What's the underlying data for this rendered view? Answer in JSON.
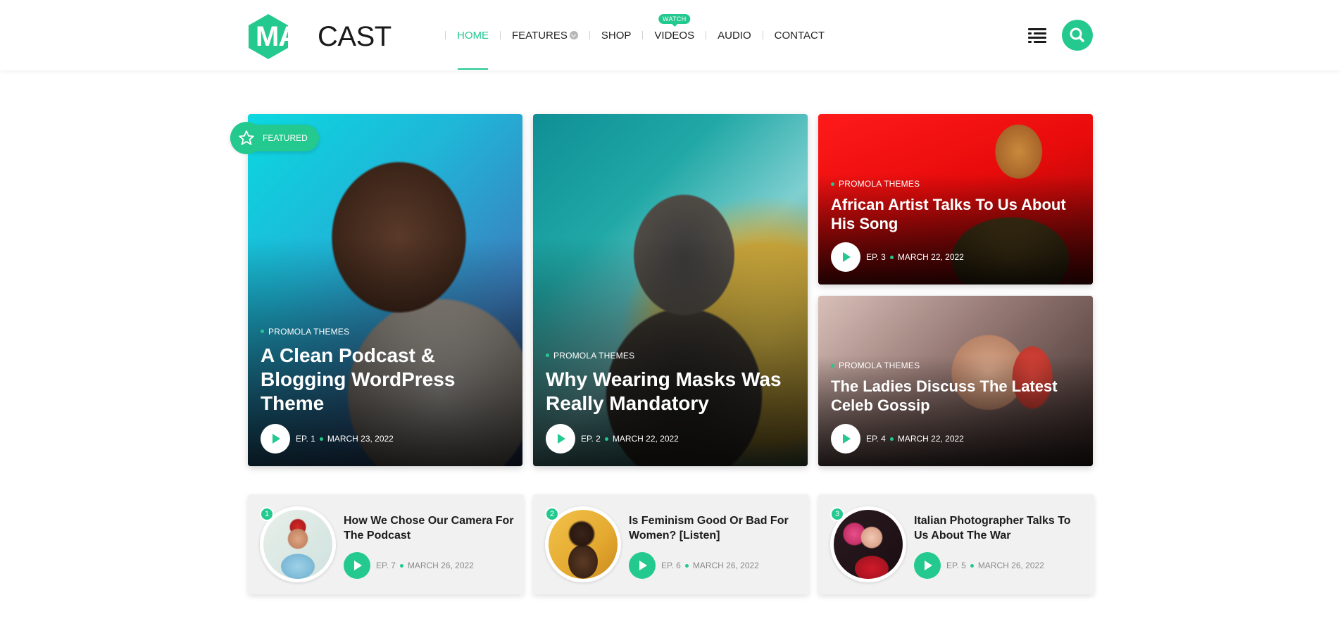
{
  "brand": {
    "logo_part1": "MAX",
    "logo_part2": "CAST",
    "accent": "#23c98f"
  },
  "nav": {
    "items": [
      {
        "label": "HOME",
        "active": true
      },
      {
        "label": "FEATURES",
        "has_dropdown": true
      },
      {
        "label": "SHOP"
      },
      {
        "label": "VIDEOS",
        "badge": "WATCH"
      },
      {
        "label": "AUDIO"
      },
      {
        "label": "CONTACT"
      }
    ]
  },
  "header_icons": {
    "menu": "menu-lines-icon",
    "search": "search-icon"
  },
  "featured_badge": "FEATURED",
  "cards": [
    {
      "category": "PROMOLA THEMES",
      "title": "A Clean Podcast & Blogging WordPress Theme",
      "episode": "EP. 1",
      "date": "MARCH 23, 2022"
    },
    {
      "category": "PROMOLA THEMES",
      "title": "Why Wearing Masks Was Really Mandatory",
      "episode": "EP. 2",
      "date": "MARCH 22, 2022"
    },
    {
      "category": "PROMOLA THEMES",
      "title": "African Artist Talks To Us About His Song",
      "episode": "EP. 3",
      "date": "MARCH 22, 2022"
    },
    {
      "category": "PROMOLA THEMES",
      "title": "The Ladies Discuss The Latest Celeb Gossip",
      "episode": "EP. 4",
      "date": "MARCH 22, 2022"
    }
  ],
  "list": [
    {
      "num": "1",
      "title": "How We Chose Our Camera For The Podcast",
      "episode": "EP. 7",
      "date": "MARCH 26, 2022"
    },
    {
      "num": "2",
      "title": "Is Feminism Good Or Bad For Women? [Listen]",
      "episode": "EP. 6",
      "date": "MARCH 26, 2022"
    },
    {
      "num": "3",
      "title": "Italian Photographer Talks To Us About The War",
      "episode": "EP. 5",
      "date": "MARCH 26, 2022"
    }
  ]
}
